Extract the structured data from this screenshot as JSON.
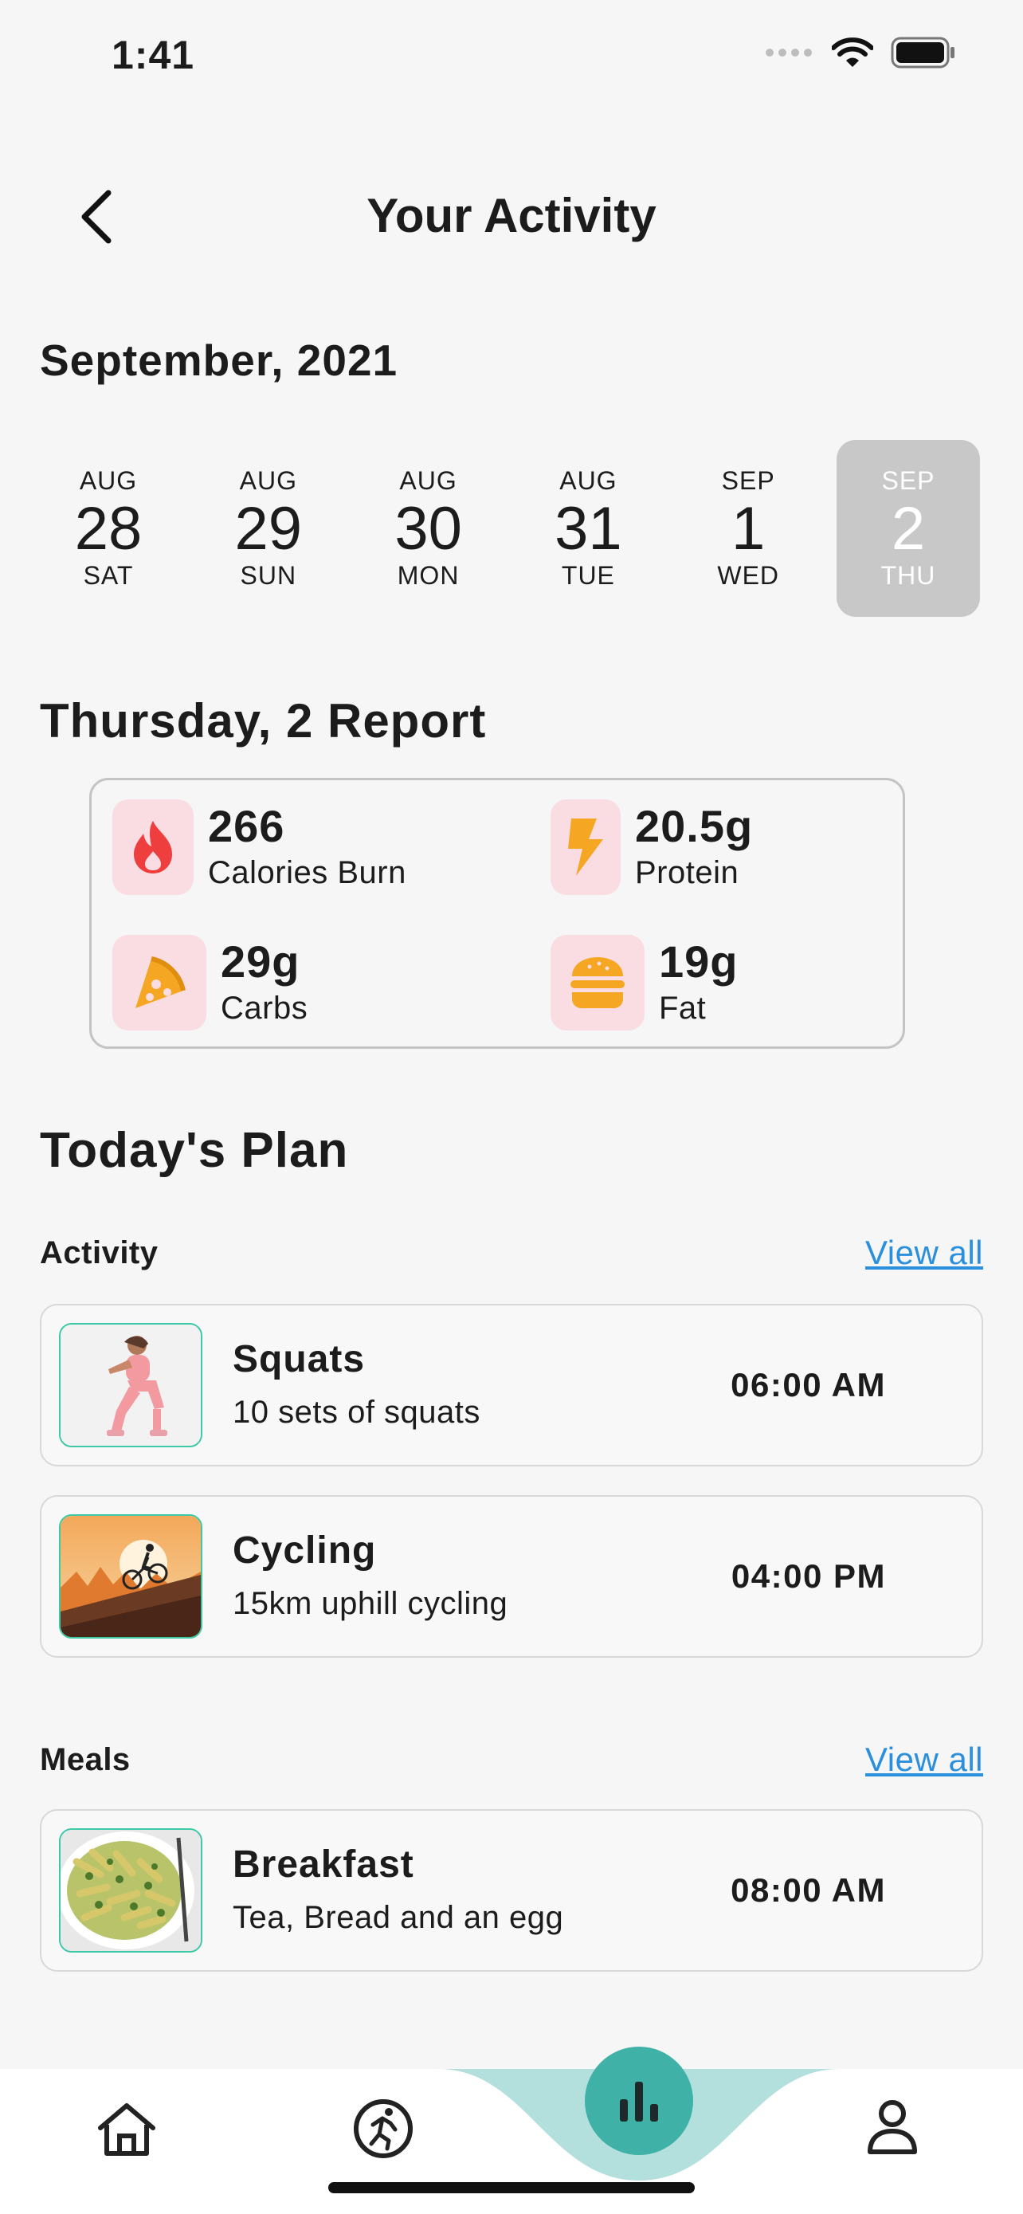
{
  "status_bar": {
    "time": "1:41"
  },
  "header": {
    "title": "Your Activity"
  },
  "month": "September, 2021",
  "dates": [
    {
      "month": "AUG",
      "day": "28",
      "weekday": "SAT",
      "selected": false
    },
    {
      "month": "AUG",
      "day": "29",
      "weekday": "SUN",
      "selected": false
    },
    {
      "month": "AUG",
      "day": "30",
      "weekday": "MON",
      "selected": false
    },
    {
      "month": "AUG",
      "day": "31",
      "weekday": "TUE",
      "selected": false
    },
    {
      "month": "SEP",
      "day": "1",
      "weekday": "WED",
      "selected": false
    },
    {
      "month": "SEP",
      "day": "2",
      "weekday": "THU",
      "selected": true
    }
  ],
  "report": {
    "title": "Thursday, 2 Report",
    "stats": [
      {
        "value": "266",
        "label": "Calories Burn",
        "icon": "flame-icon"
      },
      {
        "value": "20.5g",
        "label": "Protein",
        "icon": "lightning-icon"
      },
      {
        "value": "29g",
        "label": "Carbs",
        "icon": "pizza-icon"
      },
      {
        "value": "19g",
        "label": "Fat",
        "icon": "burger-icon"
      }
    ]
  },
  "plan": {
    "title": "Today's Plan",
    "activity": {
      "label": "Activity",
      "view_all": "View all",
      "items": [
        {
          "title": "Squats",
          "subtitle": "10 sets of squats",
          "time": "06:00 AM"
        },
        {
          "title": "Cycling",
          "subtitle": "15km uphill cycling",
          "time": "04:00 PM"
        }
      ]
    },
    "meals": {
      "label": "Meals",
      "view_all": "View all",
      "items": [
        {
          "title": "Breakfast",
          "subtitle": "Tea, Bread and an egg",
          "time": "08:00 AM"
        }
      ]
    }
  },
  "bottom_nav": {
    "items": [
      {
        "icon": "home-icon",
        "active": false
      },
      {
        "icon": "running-icon",
        "active": false
      },
      {
        "icon": "bar-chart-icon",
        "active": true
      },
      {
        "icon": "profile-icon",
        "active": false
      }
    ],
    "accent": "#3fb1a6",
    "accent_light": "#b3e0dc"
  },
  "colors": {
    "icon_bg": "#fadde3",
    "icon_orange": "#f5a623",
    "flame_red": "#ef3e3e",
    "link": "#2a8fdc",
    "selected_date_bg": "#c8c8c8"
  }
}
